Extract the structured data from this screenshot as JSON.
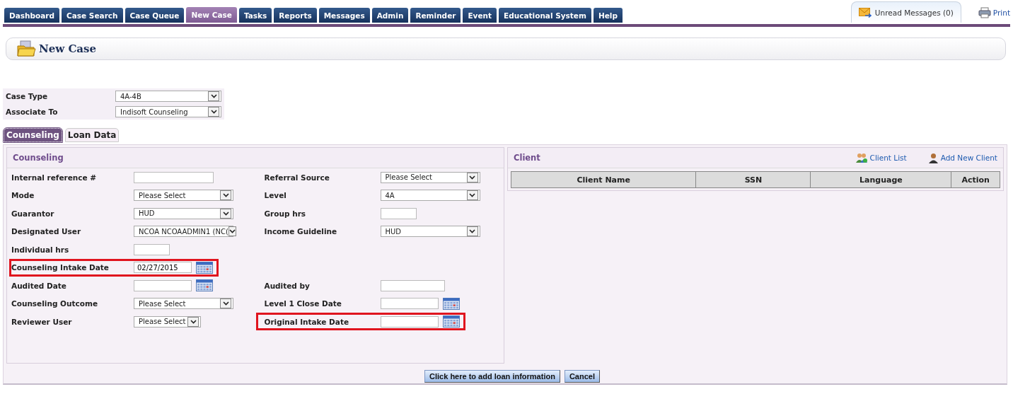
{
  "nav_tabs": [
    {
      "label": "Dashboard",
      "selected": false
    },
    {
      "label": "Case Search",
      "selected": false
    },
    {
      "label": "Case Queue",
      "selected": false
    },
    {
      "label": "New Case",
      "selected": true
    },
    {
      "label": "Tasks",
      "selected": false
    },
    {
      "label": "Reports",
      "selected": false
    },
    {
      "label": "Messages",
      "selected": false
    },
    {
      "label": "Admin",
      "selected": false
    },
    {
      "label": "Reminder",
      "selected": false
    },
    {
      "label": "Event",
      "selected": false
    },
    {
      "label": "Educational System",
      "selected": false
    },
    {
      "label": "Help",
      "selected": false
    }
  ],
  "unread_tab": {
    "label": "Unread Messages (0)"
  },
  "print_link": {
    "label": "Print"
  },
  "page_title": "New Case",
  "case_fields": [
    {
      "label": "Case Type",
      "value": "4A-4B"
    },
    {
      "label": "Associate To",
      "value": "Indisoft Counseling"
    }
  ],
  "sub_tabs": [
    {
      "label": "Counseling",
      "selected": true
    },
    {
      "label": "Loan Data",
      "selected": false
    }
  ],
  "counseling": {
    "title": "Counseling",
    "rows": [
      {
        "left": {
          "label": "Internal reference #",
          "kind": "text",
          "highlighted": false
        },
        "right": {
          "label": "Referral Source",
          "kind": "select",
          "value": "Please Select",
          "highlighted": false
        }
      },
      {
        "left": {
          "label": "Mode",
          "kind": "select",
          "value": "Please Select",
          "highlighted": false
        },
        "right": {
          "label": "Level",
          "kind": "select",
          "value": "4A",
          "highlighted": false
        }
      },
      {
        "left": {
          "label": "Guarantor",
          "kind": "select",
          "value": "HUD",
          "highlighted": false
        },
        "right": {
          "label": "Group hrs",
          "kind": "text_short",
          "highlighted": false
        }
      },
      {
        "left": {
          "label": "Designated User",
          "kind": "select",
          "value": "NCOA NCOAADMIN1 (NC(",
          "highlighted": false
        },
        "right": {
          "label": "Income Guideline",
          "kind": "select",
          "value": "HUD",
          "highlighted": false
        }
      },
      {
        "left": {
          "label": "Individual hrs",
          "kind": "text_short",
          "highlighted": false
        }
      },
      {
        "left": {
          "label": "Counseling Intake Date",
          "kind": "date",
          "value": "02/27/2015",
          "highlighted": true
        }
      },
      {
        "left": {
          "label": "Audited Date",
          "kind": "date",
          "highlighted": false
        },
        "right": {
          "label": "Audited by",
          "kind": "text_medium",
          "highlighted": false
        }
      },
      {
        "left": {
          "label": "Counseling Outcome",
          "kind": "select",
          "value": "Please Select",
          "highlighted": false
        },
        "right": {
          "label": "Level 1 Close Date",
          "kind": "date",
          "highlighted": false
        }
      },
      {
        "left": {
          "label": "Reviewer User",
          "kind": "select_short",
          "value": "Please Select",
          "highlighted": false
        },
        "right": {
          "label": "Original Intake Date",
          "kind": "date",
          "highlighted": true
        }
      }
    ]
  },
  "client": {
    "title": "Client",
    "links": [
      {
        "label": "Client List",
        "kind": "group"
      },
      {
        "label": "Add New Client",
        "kind": "person"
      }
    ],
    "columns": [
      "Client Name",
      "SSN",
      "Language",
      "Action"
    ]
  },
  "buttons": [
    "Click here to add loan information",
    "Cancel"
  ]
}
